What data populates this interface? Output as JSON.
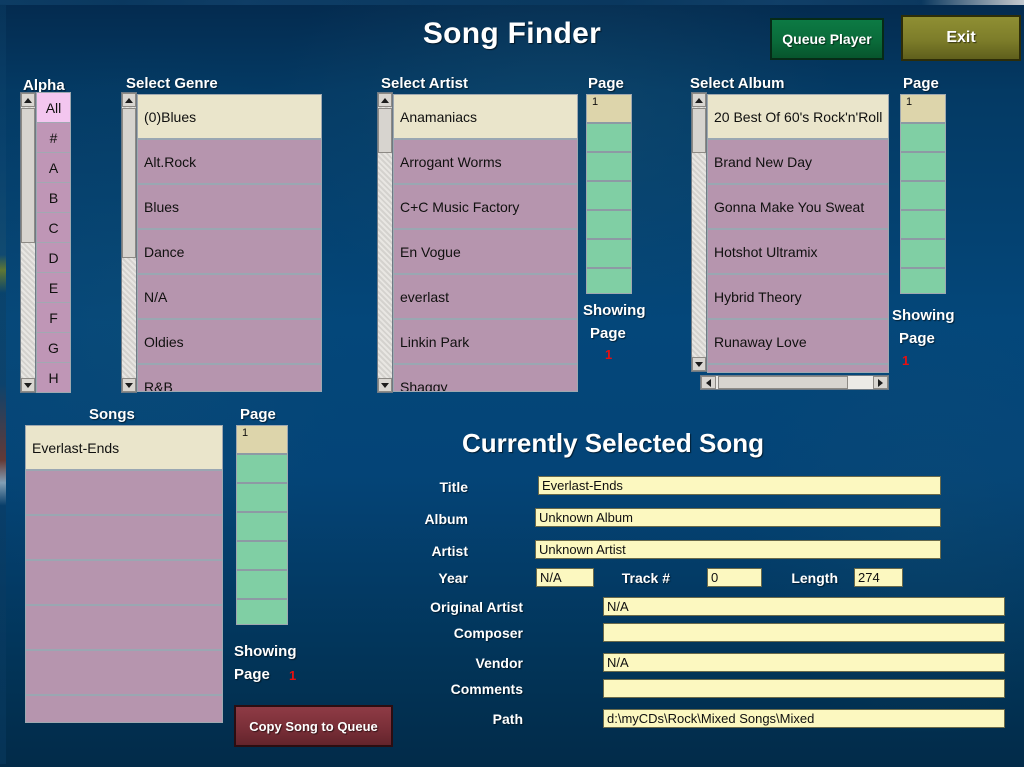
{
  "app": {
    "title": "Song Finder"
  },
  "buttons": {
    "queue_player": "Queue Player",
    "exit": "Exit",
    "copy_song_to_queue": "Copy Song to Queue"
  },
  "headers": {
    "alpha": "Alpha",
    "select_genre": "Select  Genre",
    "select_artist": "Select  Artist",
    "select_album": "Select  Album",
    "songs": "Songs",
    "page": "Page"
  },
  "showing": {
    "line1": "Showing",
    "line2": "Page",
    "value": "1"
  },
  "alpha_list": {
    "items": [
      "All",
      "#",
      "A",
      "B",
      "C",
      "D",
      "E",
      "F",
      "G",
      "H"
    ],
    "selected": "All"
  },
  "genre_list": {
    "items": [
      "(0)Blues",
      "Alt.Rock",
      "Blues",
      "Dance",
      "N/A",
      "Oldies",
      "R&B"
    ],
    "selected": "(0)Blues"
  },
  "artist_list": {
    "items": [
      "Anamaniacs",
      "Arrogant Worms",
      "C+C Music Factory",
      "En Vogue",
      "everlast",
      "Linkin Park",
      "Shaggy"
    ],
    "selected": "Anamaniacs"
  },
  "album_list": {
    "items": [
      "20 Best Of 60's Rock'n'Roll",
      "Brand New Day",
      "Gonna Make You Sweat",
      "Hotshot Ultramix",
      "Hybrid Theory",
      "Runaway Love",
      ""
    ],
    "selected": "20 Best Of 60's Rock'n'Roll"
  },
  "song_list": {
    "items": [
      "Everlast-Ends",
      "",
      "",
      "",
      "",
      "",
      ""
    ],
    "selected": "Everlast-Ends"
  },
  "page_lists": {
    "artist_pages": [
      "1",
      "",
      "",
      "",
      "",
      "",
      ""
    ],
    "album_pages": [
      "1",
      "",
      "",
      "",
      "",
      "",
      ""
    ],
    "song_pages": [
      "1",
      "",
      "",
      "",
      "",
      "",
      ""
    ],
    "selected": "1"
  },
  "currently_selected_song": {
    "heading": "Currently Selected Song",
    "fields": {
      "title_label": "Title",
      "title_value": "Everlast-Ends",
      "album_label": "Album",
      "album_value": "Unknown Album",
      "artist_label": "Artist",
      "artist_value": "Unknown Artist",
      "year_label": "Year",
      "year_value": "N/A",
      "track_label": "Track #",
      "track_value": "0",
      "length_label": "Length",
      "length_value": "274",
      "original_artist_label": "Original Artist",
      "original_artist_value": "N/A",
      "composer_label": "Composer",
      "composer_value": "",
      "vendor_label": "Vendor",
      "vendor_value": "N/A",
      "comments_label": "Comments",
      "comments_value": "",
      "path_label": "Path",
      "path_value": "d:\\myCDs\\Rock\\Mixed Songs\\Mixed"
    }
  },
  "colors": {
    "background_top": "#042a4e",
    "background_mid": "#04477a",
    "list_row": "#b695ae",
    "list_row_selected": "#eae5cb",
    "alpha_row": "#bf96b6",
    "alpha_row_selected": "#f3c6ef",
    "page_row": "#80cfa4",
    "page_row_selected": "#ddd5ab",
    "field_background": "#fcf8c0",
    "queue_button": "#0a6b3a",
    "exit_button": "#7d7d2a",
    "copy_button": "#7a2f38",
    "showing_number": "#e81010"
  }
}
